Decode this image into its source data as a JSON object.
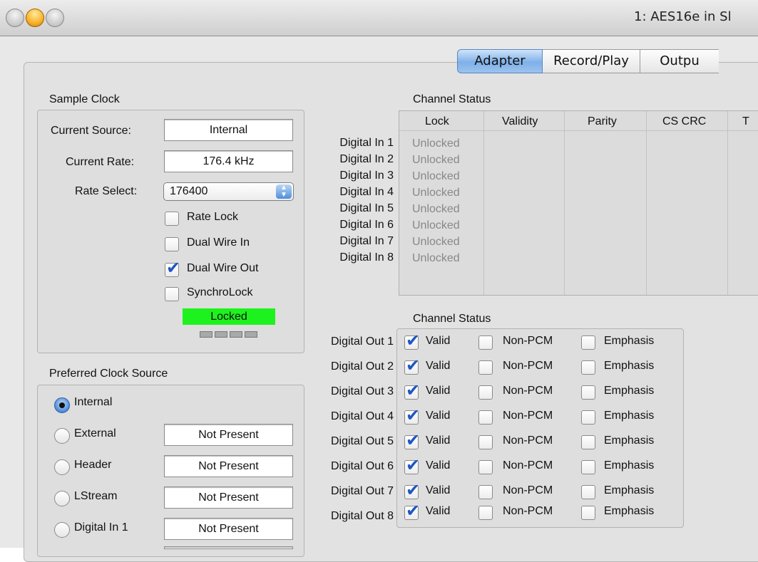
{
  "window": {
    "title": "1: AES16e in Sl"
  },
  "tabs": [
    {
      "label": "Adapter",
      "active": true,
      "width": 118
    },
    {
      "label": "Record/Play",
      "active": false,
      "width": 136
    },
    {
      "label": "Outpu",
      "active": false,
      "width": 110
    }
  ],
  "sample_clock": {
    "title": "Sample Clock",
    "current_source_label": "Current Source:",
    "current_source_value": "Internal",
    "current_rate_label": "Current Rate:",
    "current_rate_value": "176.4 kHz",
    "rate_select_label": "Rate Select:",
    "rate_select_value": "176400",
    "options": [
      {
        "label": "Rate Lock",
        "checked": false
      },
      {
        "label": "Dual Wire In",
        "checked": false
      },
      {
        "label": "Dual Wire Out",
        "checked": true
      },
      {
        "label": "SynchroLock",
        "checked": false
      }
    ],
    "status": "Locked"
  },
  "preferred_clock": {
    "title": "Preferred Clock Source",
    "sources": [
      {
        "label": "Internal",
        "selected": true,
        "value": ""
      },
      {
        "label": "External",
        "selected": false,
        "value": "Not Present"
      },
      {
        "label": "Header",
        "selected": false,
        "value": "Not Present"
      },
      {
        "label": "LStream",
        "selected": false,
        "value": "Not Present"
      },
      {
        "label": "Digital In 1",
        "selected": false,
        "value": "Not Present"
      }
    ]
  },
  "channel_status_in": {
    "title": "Channel Status",
    "columns": [
      "Lock",
      "Validity",
      "Parity",
      "CS CRC",
      "T"
    ],
    "rows": [
      {
        "label": "Digital In 1",
        "lock": "Unlocked"
      },
      {
        "label": "Digital In 2",
        "lock": "Unlocked"
      },
      {
        "label": "Digital In 3",
        "lock": "Unlocked"
      },
      {
        "label": "Digital In 4",
        "lock": "Unlocked"
      },
      {
        "label": "Digital In 5",
        "lock": "Unlocked"
      },
      {
        "label": "Digital In 6",
        "lock": "Unlocked"
      },
      {
        "label": "Digital In 7",
        "lock": "Unlocked"
      },
      {
        "label": "Digital In 8",
        "lock": "Unlocked"
      }
    ]
  },
  "channel_status_out": {
    "title": "Channel Status",
    "option_labels": [
      "Valid",
      "Non-PCM",
      "Emphasis"
    ],
    "rows": [
      {
        "label": "Digital Out 1",
        "valid": true,
        "non_pcm": false,
        "emphasis": false
      },
      {
        "label": "Digital Out 2",
        "valid": true,
        "non_pcm": false,
        "emphasis": false
      },
      {
        "label": "Digital Out 3",
        "valid": true,
        "non_pcm": false,
        "emphasis": false
      },
      {
        "label": "Digital Out 4",
        "valid": true,
        "non_pcm": false,
        "emphasis": false
      },
      {
        "label": "Digital Out 5",
        "valid": true,
        "non_pcm": false,
        "emphasis": false
      },
      {
        "label": "Digital Out 6",
        "valid": true,
        "non_pcm": false,
        "emphasis": false
      },
      {
        "label": "Digital Out 7",
        "valid": true,
        "non_pcm": false,
        "emphasis": false
      },
      {
        "label": "Digital Out 8",
        "valid": true,
        "non_pcm": false,
        "emphasis": false
      }
    ]
  }
}
